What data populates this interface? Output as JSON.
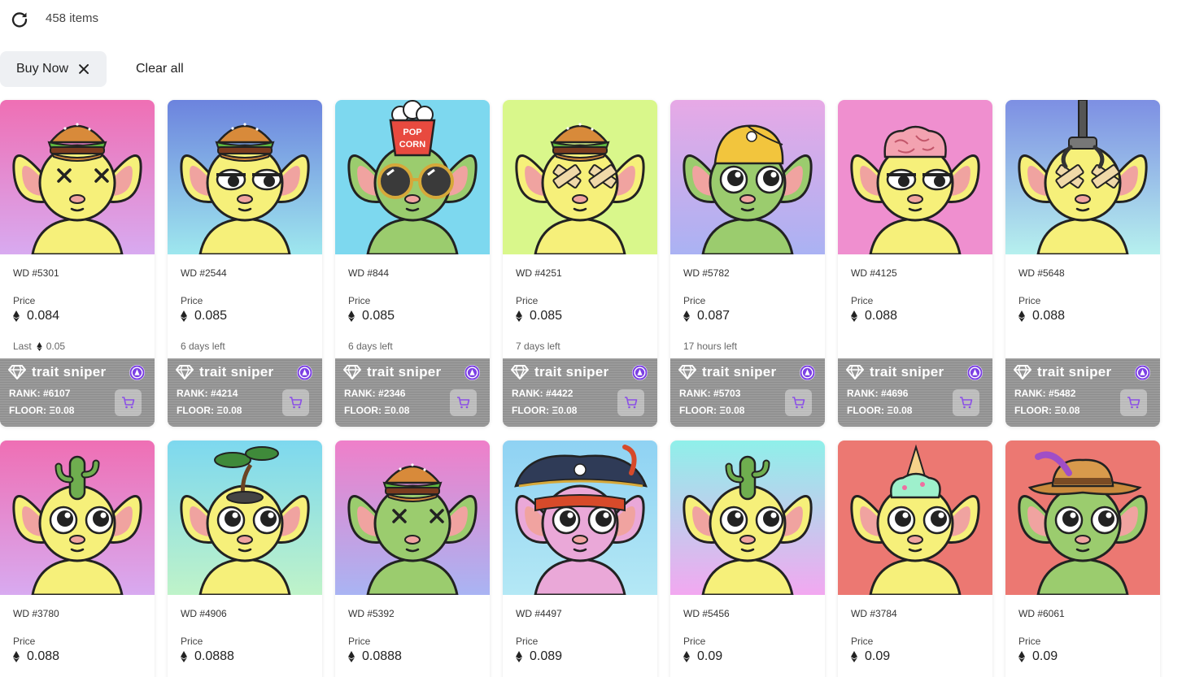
{
  "header": {
    "item_count": "458 items"
  },
  "filters": {
    "chips": [
      {
        "label": "Buy Now"
      }
    ],
    "clear_label": "Clear all"
  },
  "labels": {
    "price": "Price",
    "last": "Last",
    "brand": "trait sniper",
    "rank_prefix": "RANK:",
    "floor_prefix": "FLOOR:"
  },
  "cards": [
    {
      "name": "WD #5301",
      "price": "0.084",
      "footer": "Last",
      "last_price": "0.05",
      "rank": "#6107",
      "floor": "Ξ0.08",
      "bg": [
        "#ef6fb4",
        "#d8aaf0"
      ],
      "skin": "#f6f07a",
      "hat": "burger",
      "eyes": "x"
    },
    {
      "name": "WD #2544",
      "price": "0.085",
      "footer": "6 days left",
      "rank": "#4214",
      "floor": "Ξ0.08",
      "bg": [
        "#6c83de",
        "#9ee7ee"
      ],
      "skin": "#f6f07a",
      "hat": "burger",
      "eyes": "tired"
    },
    {
      "name": "WD #844",
      "price": "0.085",
      "footer": "6 days left",
      "rank": "#2346",
      "floor": "Ξ0.08",
      "bg": [
        "#7dd8ef",
        "#7dd8ef"
      ],
      "skin": "#9bcc6e",
      "hat": "popcorn",
      "eyes": "glasses"
    },
    {
      "name": "WD #4251",
      "price": "0.085",
      "footer": "7 days left",
      "rank": "#4422",
      "floor": "Ξ0.08",
      "bg": [
        "#d9f78b",
        "#d9f78b"
      ],
      "skin": "#f6f07a",
      "hat": "burger",
      "eyes": "tape"
    },
    {
      "name": "WD #5782",
      "price": "0.087",
      "footer": "17 hours left",
      "rank": "#5703",
      "floor": "Ξ0.08",
      "bg": [
        "#e7a9e6",
        "#aab2f3"
      ],
      "skin": "#9bcc6e",
      "hat": "cap",
      "eyes": "big"
    },
    {
      "name": "WD #4125",
      "price": "0.088",
      "footer": "",
      "rank": "#4696",
      "floor": "Ξ0.08",
      "bg": [
        "#ef8fcf",
        "#ef8fcf"
      ],
      "skin": "#f6f07a",
      "hat": "brain",
      "eyes": "tired"
    },
    {
      "name": "WD #5648",
      "price": "0.088",
      "footer": "",
      "rank": "#5482",
      "floor": "Ξ0.08",
      "bg": [
        "#7d8fe3",
        "#b6f0ee"
      ],
      "skin": "#f6f07a",
      "hat": "claw",
      "eyes": "tape"
    },
    {
      "name": "WD #3780",
      "price": "0.088",
      "bg": [
        "#ef6fb4",
        "#d8aaf0"
      ],
      "skin": "#f6f07a",
      "hat": "cactus",
      "eyes": "big"
    },
    {
      "name": "WD #4906",
      "price": "0.0888",
      "bg": [
        "#7dd8ef",
        "#bff3c9"
      ],
      "skin": "#f6f07a",
      "hat": "bonsai",
      "eyes": "big"
    },
    {
      "name": "WD #5392",
      "price": "0.0888",
      "bg": [
        "#ef7fc9",
        "#a9b4f3"
      ],
      "skin": "#9bcc6e",
      "hat": "burger",
      "eyes": "x"
    },
    {
      "name": "WD #4497",
      "price": "0.089",
      "bg": [
        "#8fd2f3",
        "#b4e8f5"
      ],
      "skin": "#eaa8d8",
      "hat": "pirate",
      "eyes": "big"
    },
    {
      "name": "WD #5456",
      "price": "0.09",
      "bg": [
        "#8ff0ea",
        "#f2a8f0"
      ],
      "skin": "#f6f07a",
      "hat": "cactus",
      "eyes": "big"
    },
    {
      "name": "WD #3784",
      "price": "0.09",
      "bg": [
        "#ec7872",
        "#ec7872"
      ],
      "skin": "#f6f07a",
      "hat": "icecream",
      "eyes": "big"
    },
    {
      "name": "WD #6061",
      "price": "0.09",
      "bg": [
        "#ec7872",
        "#ec7872"
      ],
      "skin": "#9bcc6e",
      "hat": "fedora",
      "eyes": "big"
    }
  ]
}
